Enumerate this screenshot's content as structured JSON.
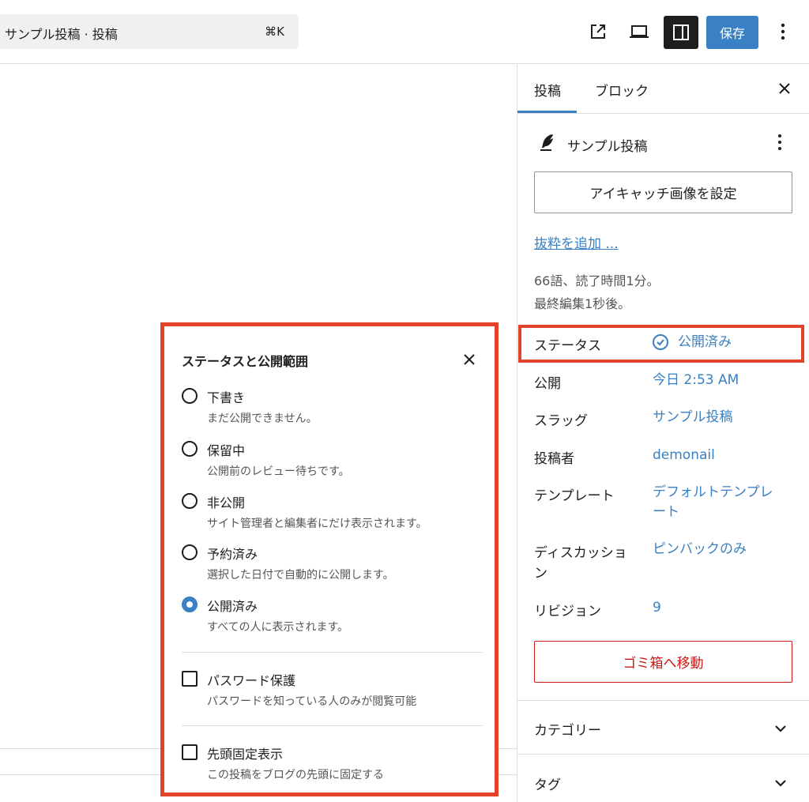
{
  "header": {
    "command_title": "サンプル投稿 · 投稿",
    "command_shortcut": "⌘K",
    "save_label": "保存",
    "accent_color": "#3a80c4"
  },
  "sidebar": {
    "tabs": [
      {
        "label": "投稿"
      },
      {
        "label": "ブロック"
      }
    ],
    "post_title": "サンプル投稿",
    "featured_image_label": "アイキャッチ画像を設定",
    "excerpt_link": "抜粋を追加 ...",
    "meta_words": "66語、読了時間1分。",
    "meta_edited": "最終編集1秒後。",
    "rows": [
      {
        "label": "ステータス",
        "value": "公開済み"
      },
      {
        "label": "公開",
        "value": "今日 2:53 AM"
      },
      {
        "label": "スラッグ",
        "value": "サンプル投稿"
      },
      {
        "label": "投稿者",
        "value": "demonail"
      },
      {
        "label": "テンプレート",
        "value_line1": "デフォルトテンプレ",
        "value_line2": "ート"
      },
      {
        "label_line1": "ディスカッショ",
        "label_line2": "ン",
        "value": "ピンバックのみ"
      },
      {
        "label": "リビジョン",
        "value": "9"
      }
    ],
    "trash_label": "ゴミ箱へ移動",
    "panels": [
      {
        "title": "カテゴリー"
      },
      {
        "title": "タグ"
      }
    ]
  },
  "popover": {
    "title": "ステータスと公開範囲",
    "options": [
      {
        "label": "下書き",
        "description": "まだ公開できません。",
        "checked": false
      },
      {
        "label": "保留中",
        "description": "公開前のレビュー待ちです。",
        "checked": false
      },
      {
        "label": "非公開",
        "description": "サイト管理者と編集者にだけ表示されます。",
        "checked": false
      },
      {
        "label": "予約済み",
        "description": "選択した日付で自動的に公開します。",
        "checked": false
      },
      {
        "label": "公開済み",
        "description": "すべての人に表示されます。",
        "checked": true
      }
    ],
    "password": {
      "label": "パスワード保護",
      "description": "パスワードを知っている人のみが閲覧可能"
    },
    "sticky": {
      "label": "先頭固定表示",
      "description": "この投稿をブログの先頭に固定する"
    }
  },
  "highlight_color": "#e2432a"
}
